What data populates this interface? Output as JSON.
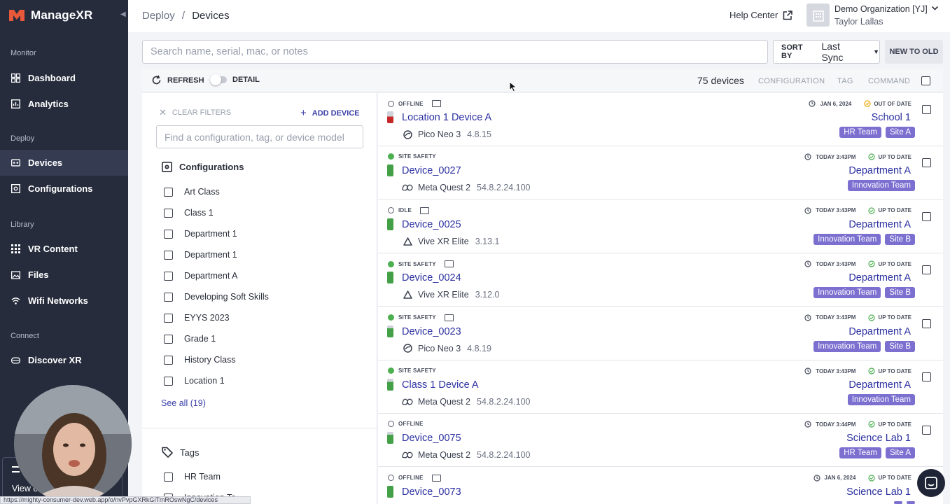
{
  "app": {
    "name": "ManageXR"
  },
  "sidebar": {
    "sections": [
      {
        "title": "Monitor",
        "items": [
          {
            "label": "Dashboard",
            "icon": "dashboard-icon"
          },
          {
            "label": "Analytics",
            "icon": "analytics-icon"
          }
        ]
      },
      {
        "title": "Deploy",
        "items": [
          {
            "label": "Devices",
            "icon": "devices-icon",
            "active": true
          },
          {
            "label": "Configurations",
            "icon": "configurations-icon"
          }
        ]
      },
      {
        "title": "Library",
        "items": [
          {
            "label": "VR Content",
            "icon": "grid-icon"
          },
          {
            "label": "Files",
            "icon": "files-icon"
          },
          {
            "label": "Wifi Networks",
            "icon": "wifi-icon"
          }
        ]
      },
      {
        "title": "Connect",
        "items": [
          {
            "label": "Discover XR",
            "icon": "discover-icon"
          }
        ]
      }
    ],
    "bottom_partial_label": "View o"
  },
  "header": {
    "breadcrumb_parent": "Deploy",
    "breadcrumb_sep": "/",
    "breadcrumb_current": "Devices",
    "help": "Help Center",
    "org_name": "Demo Organization [YJ]",
    "user_name": "Taylor Lallas"
  },
  "search": {
    "placeholder": "Search name, serial, mac, or notes"
  },
  "sort": {
    "label": "SORT BY",
    "value": "Last Sync",
    "order": "NEW TO OLD"
  },
  "toolbar": {
    "refresh": "REFRESH",
    "detail": "DETAIL",
    "count": "75 devices",
    "configuration": "CONFIGURATION",
    "tag": "TAG",
    "command": "COMMAND"
  },
  "filters": {
    "clear": "CLEAR FILTERS",
    "add_device": "ADD DEVICE",
    "search_placeholder": "Find a configuration, tag, or device model",
    "configurations_title": "Configurations",
    "configurations": [
      "Art Class",
      "Class 1",
      "Department 1",
      "Department 1",
      "Department A",
      "Developing Soft Skills",
      "EYYS 2023",
      "Grade 1",
      "History Class",
      "Location 1"
    ],
    "see_all": "See all (19)",
    "tags_title": "Tags",
    "tags": [
      "HR Team",
      "Innovation Te"
    ]
  },
  "devices": [
    {
      "status": "OFFLINE",
      "cast": true,
      "name": "Location 1 Device A",
      "model": "Pico Neo 3",
      "version": "4.8.15",
      "sync": "JAN 6, 2024",
      "update": "OUT OF DATE",
      "configuration": "School 1",
      "tags": [
        "HR Team",
        "Site A"
      ],
      "battery": "low"
    },
    {
      "status": "SITE SAFETY",
      "cast": false,
      "name": "Device_0027",
      "model": "Meta Quest 2",
      "version": "54.8.2.24.100",
      "sync": "TODAY 3:43PM",
      "update": "UP TO DATE",
      "configuration": "Department A",
      "tags": [
        "Innovation Team"
      ],
      "battery": "full"
    },
    {
      "status": "IDLE",
      "cast": true,
      "name": "Device_0025",
      "model": "Vive XR Elite",
      "version": "3.13.1",
      "sync": "TODAY 3:43PM",
      "update": "UP TO DATE",
      "configuration": "Department A",
      "tags": [
        "Innovation Team",
        "Site B"
      ],
      "battery": "full"
    },
    {
      "status": "SITE SAFETY",
      "cast": true,
      "name": "Device_0024",
      "model": "Vive XR Elite",
      "version": "3.12.0",
      "sync": "TODAY 3:43PM",
      "update": "UP TO DATE",
      "configuration": "Department A",
      "tags": [
        "Innovation Team",
        "Site B"
      ],
      "battery": "full"
    },
    {
      "status": "SITE SAFETY",
      "cast": true,
      "name": "Device_0023",
      "model": "Pico Neo 3",
      "version": "4.8.19",
      "sync": "TODAY 3:43PM",
      "update": "UP TO DATE",
      "configuration": "Department A",
      "tags": [
        "Innovation Team",
        "Site B"
      ],
      "battery": "mid"
    },
    {
      "status": "SITE SAFETY",
      "cast": false,
      "name": "Class 1 Device A",
      "model": "Meta Quest 2",
      "version": "54.8.2.24.100",
      "sync": "TODAY 3:43PM",
      "update": "UP TO DATE",
      "configuration": "Department A",
      "tags": [
        "Innovation Team"
      ],
      "battery": "mid"
    },
    {
      "status": "OFFLINE",
      "cast": false,
      "name": "Device_0075",
      "model": "Meta Quest 2",
      "version": "54.8.2.24.100",
      "sync": "TODAY 3:44PM",
      "update": "UP TO DATE",
      "configuration": "Science Lab 1",
      "tags": [
        "HR Team",
        "Site A"
      ],
      "battery": "mid"
    },
    {
      "status": "OFFLINE",
      "cast": true,
      "name": "Device_0073",
      "model": "",
      "version": "",
      "sync": "JAN 6, 2024",
      "update": "UP TO DATE",
      "configuration": "Science Lab 1",
      "tags": [
        "",
        ""
      ],
      "battery": "full"
    }
  ],
  "status_bar": {
    "url": "https://mighty-consumer-dev.web.app/o/nvPvpGXRkGiTmROswNgC/devices"
  },
  "colors": {
    "sidebar": "#262c3c",
    "accent": "#2c31a0",
    "tag": "#7b6fd0",
    "online": "#4caf50",
    "warning": "#f0a500"
  }
}
